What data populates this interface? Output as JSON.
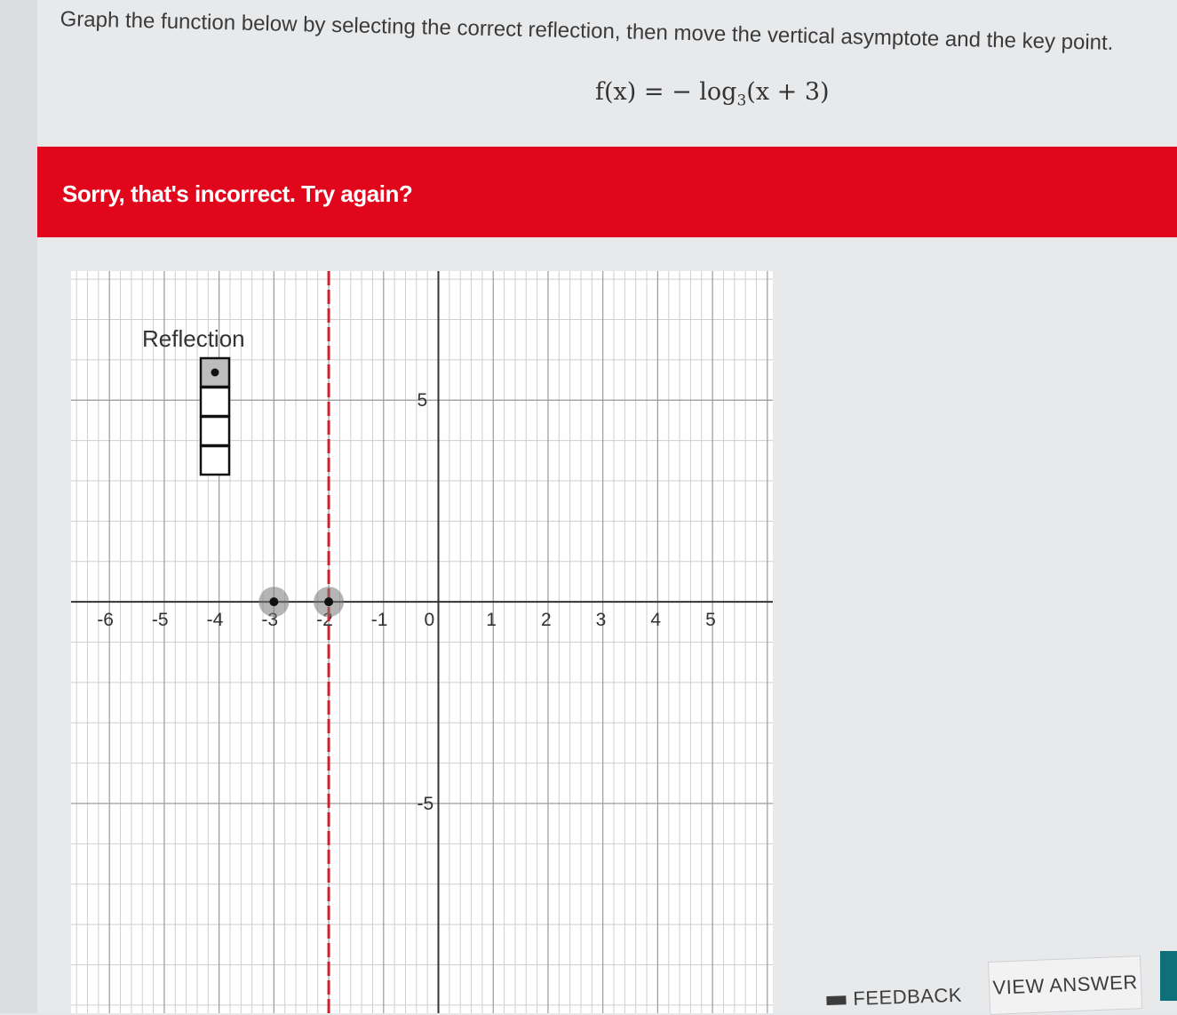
{
  "question": {
    "instruction": "Graph the function below by selecting the correct reflection, then move the vertical asymptote and the key point.",
    "function": {
      "lhs": "f(x) = − log",
      "base": "3",
      "arg": "(x + 3)"
    }
  },
  "feedback": {
    "message": "Sorry, that's incorrect. Try again?",
    "color": "#e2061c"
  },
  "reflection": {
    "label": "Reflection",
    "option_count": 4,
    "selected_index": 0
  },
  "chart_data": {
    "type": "line",
    "x_ticks": [
      "-6",
      "-5",
      "-4",
      "-3",
      "-2",
      "-1",
      "0",
      "1",
      "2",
      "3",
      "4",
      "5"
    ],
    "y_ticks": [
      "5",
      "-5"
    ],
    "grid": true,
    "curve_color": "#2e5f95",
    "asymptote_color": "#d21f2b",
    "asymptote_x": -2,
    "key_points": [
      {
        "x": -3,
        "y": 0
      },
      {
        "x": -2,
        "y": 0
      }
    ]
  },
  "actions": {
    "feedback_label": "FEEDBACK",
    "view_answer_label": "VIEW ANSWER"
  }
}
